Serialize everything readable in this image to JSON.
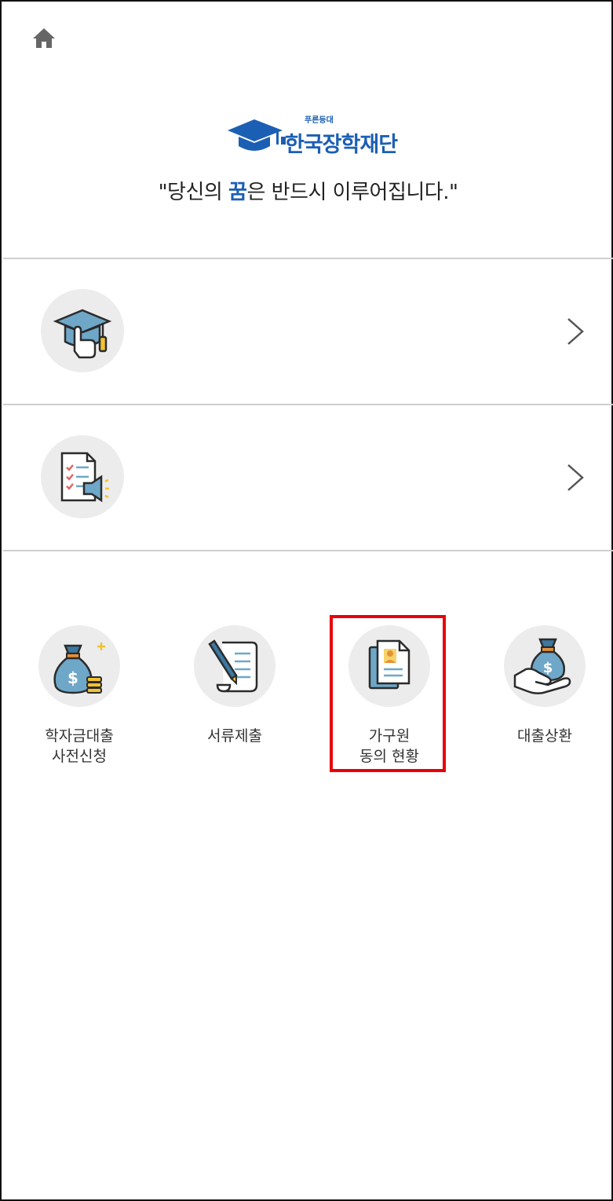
{
  "header": {
    "home_icon": "home-icon",
    "logo_small_text": "푸른등대",
    "logo_text": "한국장학재단",
    "slogan_prefix": "\"당신의 ",
    "slogan_highlight": "꿈",
    "slogan_suffix": "은 반드시 이루어집니다.\""
  },
  "menu_rows": [
    {
      "icon": "graduation-cap-hand-icon",
      "chevron": "chevron-right-icon"
    },
    {
      "icon": "document-megaphone-icon",
      "chevron": "chevron-right-icon"
    }
  ],
  "quick_menu": [
    {
      "label": "학자금대출\n사전신청",
      "icon": "money-bag-plus-icon"
    },
    {
      "label": "서류제출",
      "icon": "document-pen-icon"
    },
    {
      "label": "가구원\n동의 현황",
      "icon": "person-document-icon"
    },
    {
      "label": "대출상환",
      "icon": "money-bag-hand-icon"
    }
  ],
  "colors": {
    "brand_blue": "#1b5fb4",
    "highlight_red": "#e8000b",
    "icon_circle_bg": "#ececec",
    "divider": "#cfcfcf"
  }
}
